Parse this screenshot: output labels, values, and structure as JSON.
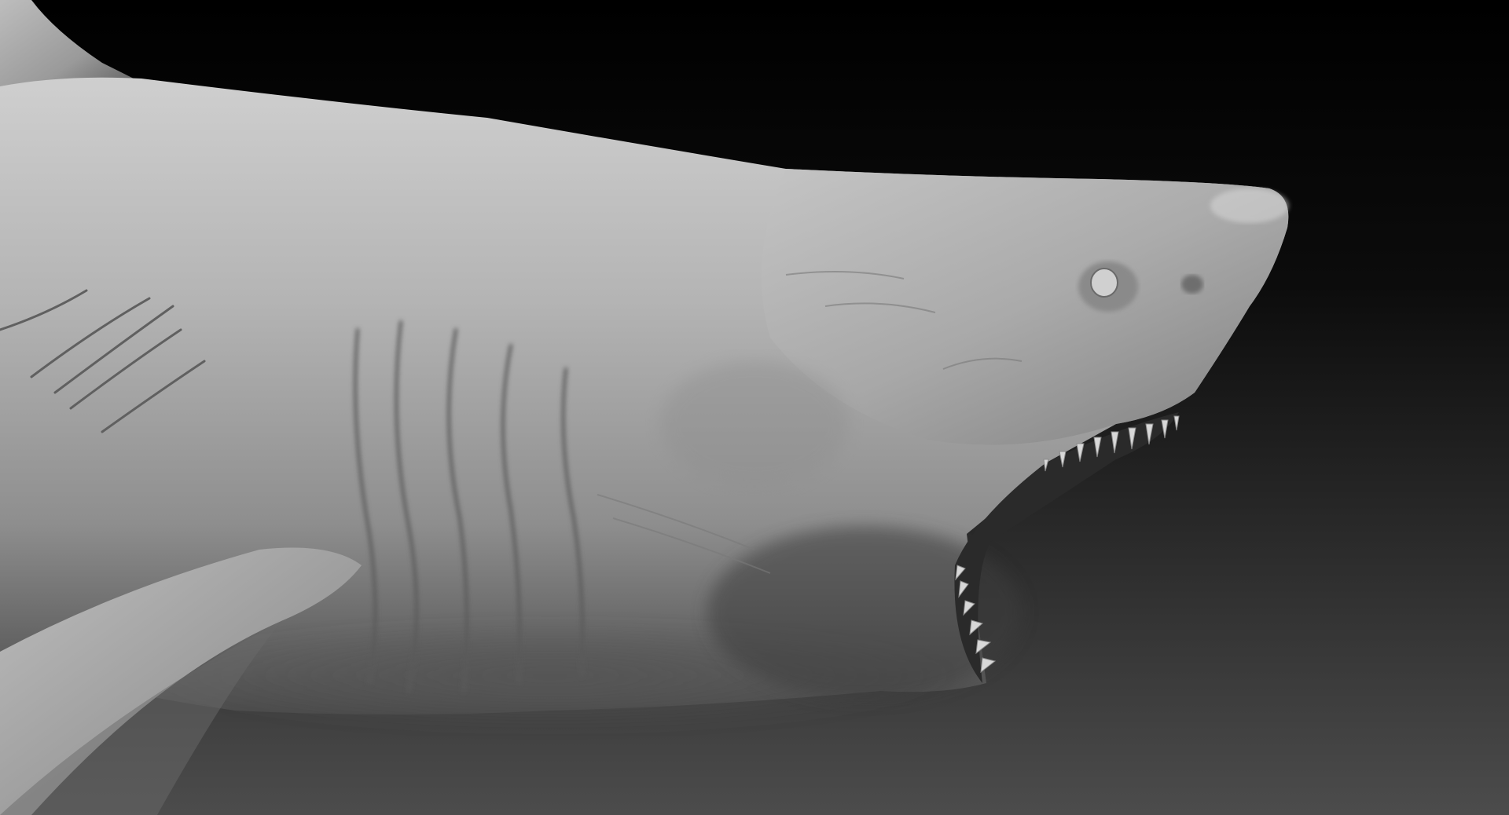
{
  "scene": {
    "subject": "shark-sculpt",
    "colors": {
      "background_top": "#000000",
      "background_bottom": "#4a4a4a",
      "clay_highlight": "#c9c9c9",
      "clay_mid": "#9a9a9a",
      "clay_shadow": "#3a3a3a",
      "wrinkle": "#5a5a5a",
      "teeth": "#d8d8d8",
      "mouth_interior": "#2a2a2a"
    }
  }
}
